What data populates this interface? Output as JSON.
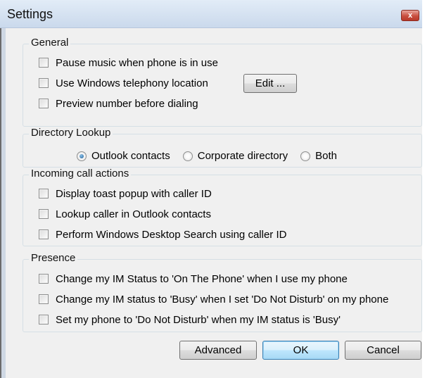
{
  "window": {
    "title": "Settings",
    "close_glyph": "x"
  },
  "general": {
    "legend": "General",
    "options": [
      {
        "label": "Pause music when phone is in use",
        "checked": false
      },
      {
        "label": "Use Windows telephony location",
        "checked": false
      },
      {
        "label": "Preview number before dialing",
        "checked": false
      }
    ],
    "edit_button": "Edit ..."
  },
  "directory_lookup": {
    "legend": "Directory Lookup",
    "options": [
      {
        "label": "Outlook contacts",
        "selected": true
      },
      {
        "label": "Corporate directory",
        "selected": false
      },
      {
        "label": "Both",
        "selected": false
      }
    ]
  },
  "incoming": {
    "legend": "Incoming call actions",
    "options": [
      {
        "label": "Display toast popup with caller ID",
        "checked": false
      },
      {
        "label": "Lookup caller in Outlook contacts",
        "checked": false
      },
      {
        "label": "Perform Windows Desktop Search using caller ID",
        "checked": false
      }
    ]
  },
  "presence": {
    "legend": "Presence",
    "options": [
      {
        "label": "Change my IM Status to 'On The Phone' when I use my phone",
        "checked": false
      },
      {
        "label": "Change my IM status to 'Busy' when I set 'Do Not Disturb' on my phone",
        "checked": false
      },
      {
        "label": "Set my phone to 'Do Not Disturb' when my IM status is 'Busy'",
        "checked": false
      }
    ]
  },
  "buttons": {
    "advanced": "Advanced",
    "ok": "OK",
    "cancel": "Cancel"
  },
  "colors": {
    "titlebar": "#cad9ec",
    "client_background": "#f0f0f0",
    "default_button_border": "#3c7fb1"
  }
}
